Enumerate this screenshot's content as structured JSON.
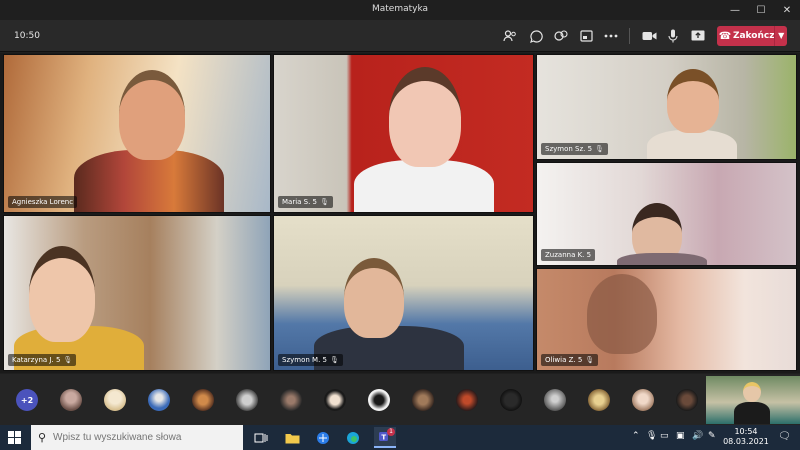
{
  "window": {
    "title": "Matematyka",
    "controls": {
      "minimize": "—",
      "maximize": "☐",
      "close": "✕"
    }
  },
  "toolbar": {
    "clock": "10:50",
    "icons": [
      "participants-icon",
      "chat-icon",
      "reactions-icon",
      "rooms-icon",
      "more-icon",
      "camera-icon",
      "mic-icon",
      "share-icon"
    ],
    "leave_label": "Zakończ",
    "leave_color": "#c4314b"
  },
  "tiles": [
    {
      "name": "Agnieszka Lorenc",
      "muted": false
    },
    {
      "name": "Maria S. 5",
      "muted": true
    },
    {
      "name": "Szymon Sz. 5",
      "muted": true
    },
    {
      "name": "Zuzanna K. 5",
      "muted": false
    },
    {
      "name": "Katarzyna J. 5",
      "muted": true
    },
    {
      "name": "Szymon M. 5",
      "muted": true
    },
    {
      "name": "Oliwia Z. 5",
      "muted": true
    }
  ],
  "strip": {
    "more_count": "+2"
  },
  "taskbar": {
    "search_placeholder": "Wpisz tu wyszukiwane słowa",
    "time": "10:54",
    "date": "08.03.2021",
    "teams_badge": "1"
  }
}
